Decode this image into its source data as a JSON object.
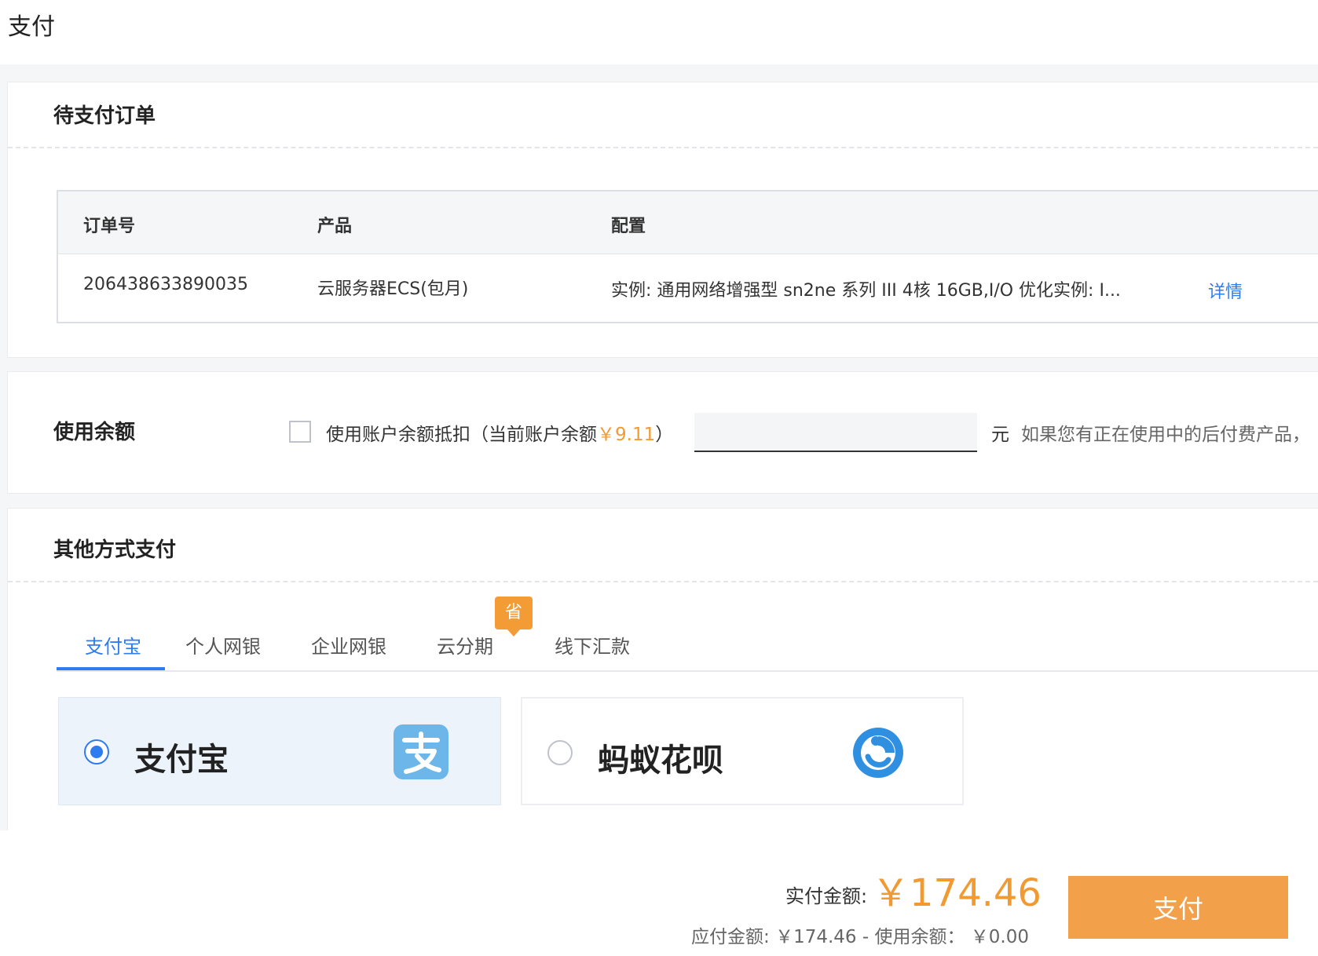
{
  "page": {
    "title": "支付"
  },
  "order_section": {
    "title": "待支付订单",
    "columns": [
      "订单号",
      "产品",
      "配置"
    ],
    "row": {
      "order_id": "206438633890035",
      "product": "云服务器ECS(包月)",
      "config": "实例: 通用网络增强型 sn2ne 系列 III 4核 16GB,I/O 优化实例: I...",
      "detail_link": "详情"
    }
  },
  "balance_section": {
    "title": "使用余额",
    "checkbox_label_prefix": "使用账户余额抵扣（当前账户余额",
    "balance_amount": "￥9.11",
    "checkbox_label_suffix": "）",
    "checkbox_checked": false,
    "input_value": "",
    "unit": "元",
    "note": "如果您有正在使用中的后付费产品，"
  },
  "other_payment_section": {
    "title": "其他方式支付",
    "tabs": [
      "支付宝",
      "个人网银",
      "企业网银",
      "云分期",
      "线下汇款"
    ],
    "active_tab": "支付宝",
    "badge": "省",
    "methods": [
      {
        "name": "支付宝",
        "selected": true,
        "icon": "alipay-icon"
      },
      {
        "name": "蚂蚁花呗",
        "selected": false,
        "icon": "huabei-icon"
      }
    ]
  },
  "footer": {
    "actual_label": "实付金额:",
    "actual_amount": "￥174.46",
    "payable_label": "应付金额:",
    "payable_amount": "￥174.46",
    "separator": "-",
    "balance_used_label": "使用余额：",
    "balance_used_amount": "￥0.00",
    "pay_button": "支付"
  },
  "colors": {
    "accent_blue": "#2f7cf0",
    "accent_orange": "#f29a32",
    "pay_button": "#f3a04a"
  }
}
